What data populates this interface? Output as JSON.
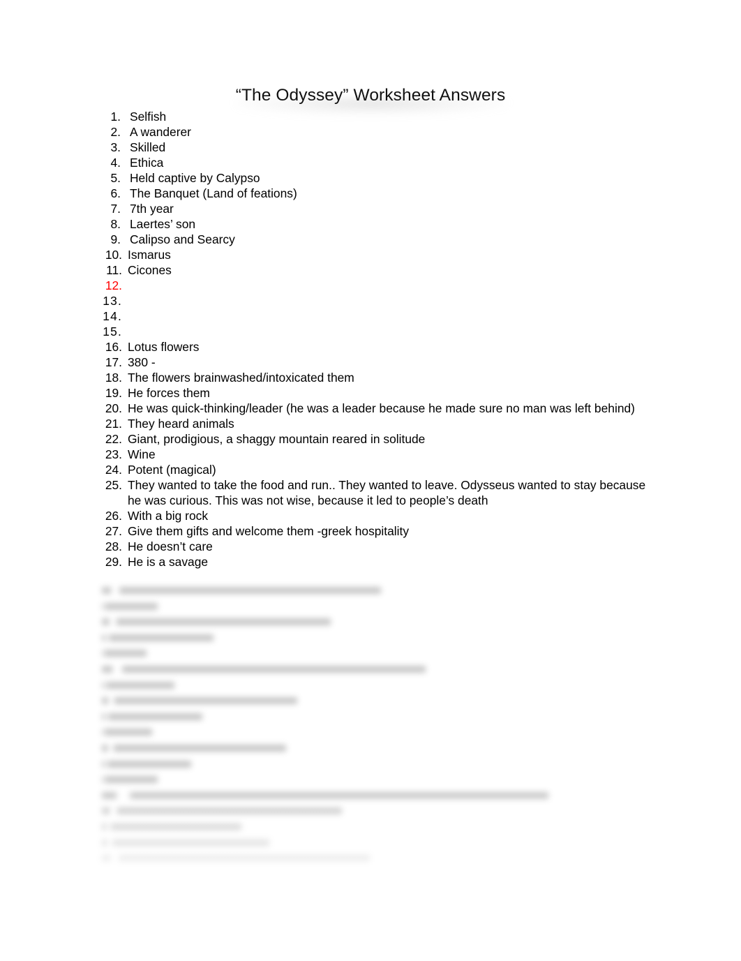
{
  "document": {
    "title": "“The Odyssey” Worksheet Answers",
    "background_color": "#ffffff",
    "text_color": "#000000",
    "highlight_color": "#ff0000"
  },
  "answers": [
    {
      "number": "1.",
      "text": "Selfish"
    },
    {
      "number": "2.",
      "text": "A wanderer"
    },
    {
      "number": "3.",
      "text": "Skilled"
    },
    {
      "number": "4.",
      "text": "Ethica"
    },
    {
      "number": "5.",
      "text": "Held captive by Calypso"
    },
    {
      "number": "6.",
      "text": "The Banquet (Land of feations)"
    },
    {
      "number": "7.",
      "text": "7th year"
    },
    {
      "number": "8.",
      "text": "Laertes’ son"
    },
    {
      "number": "9.",
      "text": "Calipso and Searcy"
    },
    {
      "number": "10.",
      "text": "Ismarus"
    },
    {
      "number": "11.",
      "text": "Cicones"
    },
    {
      "number": "12.",
      "text": ""
    },
    {
      "number": "13.",
      "text": ""
    },
    {
      "number": "14.",
      "text": ""
    },
    {
      "number": "15.",
      "text": ""
    },
    {
      "number": "16.",
      "text": "Lotus flowers"
    },
    {
      "number": "17.",
      "text": "380 -"
    },
    {
      "number": "18.",
      "text": "The flowers brainwashed/intoxicated them"
    },
    {
      "number": "19.",
      "text": "He forces them"
    },
    {
      "number": "20.",
      "text": "He was quick-thinking/leader (he was a leader because he made sure no man was left behind)"
    },
    {
      "number": "21.",
      "text": "They heard animals"
    },
    {
      "number": "22.",
      "text": "Giant, prodigious, a shaggy mountain reared in solitude"
    },
    {
      "number": "23.",
      "text": "Wine"
    },
    {
      "number": "24.",
      "text": "Potent (magical)"
    },
    {
      "number": "25.",
      "text": "They wanted to take the food and run.. They wanted to leave.  Odysseus wanted to stay because he was curious. This was not wise, because it led to people’s death"
    },
    {
      "number": "26.",
      "text": "With a big rock"
    },
    {
      "number": "27.",
      "text": "Give them gifts and welcome them -greek hospitality"
    },
    {
      "number": "28.",
      "text": "He doesn’t care"
    },
    {
      "number": "29.",
      "text": "He is a savage"
    }
  ],
  "obscured_preview": {
    "description": "blurred continuation of the answer list",
    "line_widths": [
      "50%",
      "10%",
      "41%",
      "20%",
      "8%",
      "58%",
      "13%",
      "35%",
      "18%",
      "9%",
      "33%",
      "16%",
      "10%",
      "80%",
      "43%",
      "25%",
      "30%",
      "48%"
    ]
  }
}
